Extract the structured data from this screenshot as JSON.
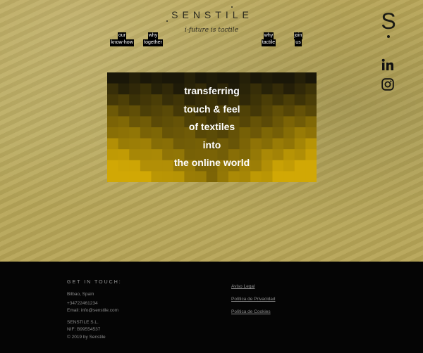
{
  "header": {
    "logo": "SENSTILE",
    "tagline": "i-future is tactile"
  },
  "nav": {
    "our_line1": "our",
    "our_line2": "know-how",
    "why_line1": "why",
    "why_line2": "together",
    "whytactile_line1": "why",
    "whytactile_line2": "tactile",
    "join_line1": "join",
    "join_line2": "us"
  },
  "side": {
    "brand_letter": "S",
    "linkedin_icon": "linkedin-icon",
    "instagram_icon": "instagram-icon"
  },
  "hero": {
    "lines": [
      "transferring",
      "touch & feel",
      "of textiles",
      "into",
      "the online world"
    ],
    "colors": {
      "top": "#1a1708",
      "bottom": "#d1a805"
    }
  },
  "footer": {
    "heading": "GET IN TOUCH:",
    "address": "Bilbao, Spain",
    "phone": "+34722461234",
    "email": "Email: info@senstile.com",
    "company": "SENSTILE S.L.",
    "nif": "NIF: B99554537",
    "copyright": "© 2019 by Senstile",
    "links": {
      "legal": "Aviso Legal",
      "privacy": "Política de Privacidad",
      "cookies": "Política de Cookies"
    }
  }
}
